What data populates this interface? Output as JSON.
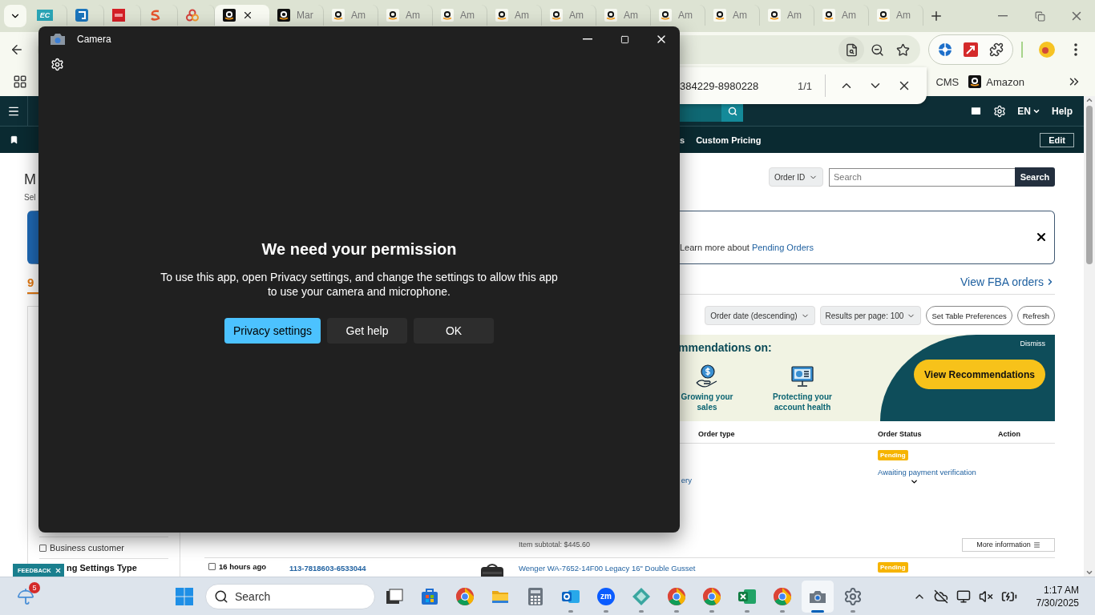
{
  "browser": {
    "tabs": [
      {
        "icon_text": "EC",
        "selected": false
      },
      {
        "selected": false
      },
      {
        "selected": false
      },
      {
        "selected": false
      },
      {
        "selected": false
      },
      {
        "selected": true
      },
      {
        "label": "Mar",
        "selected": false
      },
      {
        "label": "Am",
        "selected": false
      },
      {
        "label": "Am",
        "selected": false
      },
      {
        "label": "Am",
        "selected": false
      },
      {
        "label": "Am",
        "selected": false
      },
      {
        "label": "Am",
        "selected": false
      },
      {
        "label": "Am",
        "selected": false
      },
      {
        "label": "Am",
        "selected": false
      },
      {
        "label": "Am",
        "selected": false
      },
      {
        "label": "Am",
        "selected": false
      },
      {
        "label": "Am",
        "selected": false
      },
      {
        "label": "Am",
        "selected": false
      }
    ],
    "find": {
      "value": "384229-8980228",
      "count": "1/1"
    },
    "bookmarks": [
      "CMS",
      "Amazon"
    ]
  },
  "seller": {
    "language": "EN",
    "help": "Help",
    "nav": [
      "s",
      "Custom Pricing"
    ],
    "edit": "Edit"
  },
  "page": {
    "title": "M",
    "subtitle": "Sel",
    "search_by": "Order ID",
    "search_placeholder": "Search",
    "search_button": "Search",
    "banner": {
      "text": "Learn more about",
      "link": "Pending Orders"
    },
    "count": "9",
    "fba_link": "View FBA orders",
    "sort": "Order date (descending)",
    "per_page": "Results per page: 100",
    "buttons": [
      "Set Table Preferences",
      "Refresh"
    ],
    "recommendations": {
      "heading": "mmendations on:",
      "items": [
        "Growing your sales",
        "Protecting your account health"
      ],
      "dismiss": "Dismiss",
      "cta": "View Recommendations"
    },
    "table": {
      "headers": {
        "order_type": "Order type",
        "order_status": "Order Status",
        "action": "Action"
      },
      "rows": [
        {
          "kind": "continued",
          "product_fragment": "ery",
          "status": "Pending",
          "status_detail": "Awaiting payment verification",
          "subtotal": "Item subtotal: $445.60",
          "more": "More information"
        },
        {
          "kind": "order",
          "checked": false,
          "age": "16 hours ago",
          "order_id": "113-7818603-6533044",
          "product": "Wenger WA-7652-14F00 Legacy 16\" Double Gusset",
          "status": "Pending"
        }
      ]
    },
    "sidebar": {
      "filters": [
        {
          "label": "Business customer",
          "checked": false
        }
      ],
      "section": "ng Settings Type"
    },
    "feedback": "FEEDBACK"
  },
  "camera": {
    "title": "Camera",
    "heading": "We need your permission",
    "body": "To use this app, open Privacy settings, and change the settings to allow this app to use your camera and microphone.",
    "buttons": [
      {
        "label": "Privacy settings",
        "primary": true
      },
      {
        "label": "Get help",
        "primary": false
      },
      {
        "label": "OK",
        "primary": false
      }
    ]
  },
  "taskbar": {
    "weather_badge": "5",
    "search_placeholder": "Search",
    "apps": [
      {
        "running": false,
        "selected": false
      },
      {
        "running": false,
        "selected": false
      },
      {
        "running": false,
        "selected": false
      },
      {
        "running": false,
        "selected": false
      },
      {
        "running": false,
        "selected": false
      },
      {
        "running": true,
        "selected": false
      },
      {
        "text": "zm",
        "running": true,
        "selected": false
      },
      {
        "running": true,
        "selected": false
      },
      {
        "running": true,
        "selected": false
      },
      {
        "running": true,
        "selected": false
      },
      {
        "running": true,
        "selected": false
      },
      {
        "running": true,
        "selected": false
      },
      {
        "running": true,
        "selected": true
      },
      {
        "running": true,
        "selected": false
      }
    ],
    "time": "1:17 AM",
    "date": "7/30/2025"
  }
}
